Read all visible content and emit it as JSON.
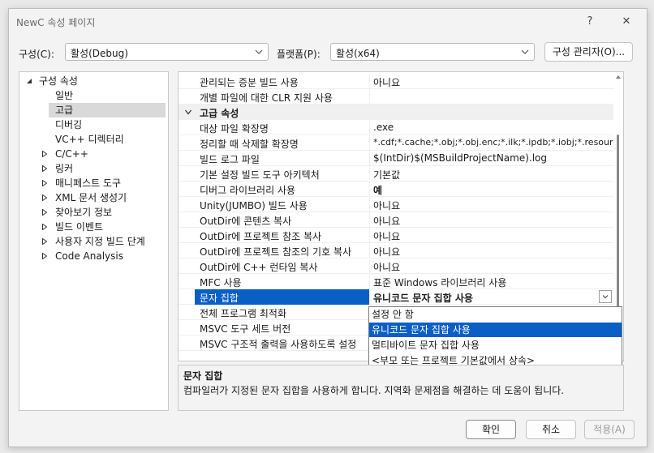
{
  "window": {
    "title": "NewC 속성 페이지",
    "help": "?",
    "close": "✕"
  },
  "config": {
    "config_label": "구성(C):",
    "config_value": "활성(Debug)",
    "platform_label": "플랫폼(P):",
    "platform_value": "활성(x64)",
    "manager_button": "구성 관리자(O)..."
  },
  "tree": [
    {
      "label": "구성 속성",
      "state": "expanded"
    },
    {
      "label": "일반"
    },
    {
      "label": "고급",
      "selected": true
    },
    {
      "label": "디버깅"
    },
    {
      "label": "VC++ 디렉터리"
    },
    {
      "label": "C/C++",
      "state": "collapsed"
    },
    {
      "label": "링커",
      "state": "collapsed"
    },
    {
      "label": "매니페스트 도구",
      "state": "collapsed"
    },
    {
      "label": "XML 문서 생성기",
      "state": "collapsed"
    },
    {
      "label": "찾아보기 정보",
      "state": "collapsed"
    },
    {
      "label": "빌드 이벤트",
      "state": "collapsed"
    },
    {
      "label": "사용자 지정 빌드 단계",
      "state": "collapsed"
    },
    {
      "label": "Code Analysis",
      "state": "collapsed"
    }
  ],
  "grid": {
    "rows": [
      {
        "name": "관리되는 증분 빌드 사용",
        "value": "아니요"
      },
      {
        "name": "개별 파일에 대한 CLR 지원 사용",
        "value": ""
      },
      {
        "name": "고급 속성",
        "category": true
      },
      {
        "name": "대상 파일 확장명",
        "value": ".exe"
      },
      {
        "name": "정리할 때 삭제할 확장명",
        "value": "*.cdf;*.cache;*.obj;*.obj.enc;*.ilk;*.ipdb;*.iobj;*.resources;*.tlb"
      },
      {
        "name": "빌드 로그 파일",
        "value": "$(IntDir)$(MSBuildProjectName).log"
      },
      {
        "name": "기본 설정 빌드 도구 아키텍처",
        "value": "기본값"
      },
      {
        "name": "디버그 라이브러리 사용",
        "value": "예",
        "bold": true
      },
      {
        "name": "Unity(JUMBO) 빌드 사용",
        "value": "아니요"
      },
      {
        "name": "OutDir에 콘텐츠 복사",
        "value": "아니요"
      },
      {
        "name": "OutDir에 프로젝트 참조 복사",
        "value": "아니요"
      },
      {
        "name": "OutDir에 프로젝트 참조의 기호 복사",
        "value": "아니요"
      },
      {
        "name": "OutDir에 C++ 런타임 복사",
        "value": "아니요"
      },
      {
        "name": "MFC 사용",
        "value": "표준 Windows 라이브러리 사용"
      },
      {
        "name": "문자 집합",
        "value": "유니코드 문자 집합 사용",
        "selected": true
      },
      {
        "name": "전체 프로그램 최적화",
        "value": ""
      },
      {
        "name": "MSVC 도구 세트 버전",
        "value": ""
      },
      {
        "name": "MSVC 구조적 출력을 사용하도록 설정",
        "value": ""
      }
    ]
  },
  "dropdown": [
    {
      "label": "설정 안 함"
    },
    {
      "label": "유니코드 문자 집합 사용",
      "highlighted": true
    },
    {
      "label": "멀티바이트 문자 집합 사용"
    },
    {
      "label": "<부모 또는 프로젝트 기본값에서 상속>"
    }
  ],
  "description": {
    "title": "문자 집합",
    "text": "컴파일러가 지정된 문자 집합을 사용하게 합니다. 지역화 문제점을 해결하는 데 도움이 됩니다."
  },
  "buttons": {
    "ok": "확인",
    "cancel": "취소",
    "apply": "적용(A)"
  },
  "colors": {
    "selection": "#0a5fc5",
    "tree_selection": "#d9d9d9",
    "disabled_text": "#9a9a9a"
  }
}
